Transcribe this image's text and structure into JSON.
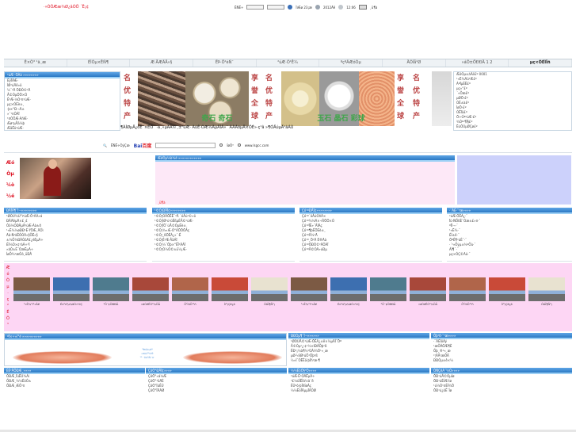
{
  "header": {
    "site_title": "·»ÒÔÆæ¾Ø¿âÓÖ ´Ë¡¢",
    "search_label": "ËÑË÷",
    "weather_label": "ÌìÆø 23¡æ",
    "date_label": "2012Äê",
    "time_label": "12:06",
    "go_button": "¸ü¶à"
  },
  "nav": {
    "items": [
      "Ê×Ò³ ¹ã¸æ",
      "ÉÌÒµ×ÊÑ¶",
      "Æ·ÅÆÃÅ»§",
      "ËÞ·Ö²éÑ¯",
      "²úÆ·Õ¹Ê¾",
      "ºçºÃÆóÒµ",
      "ÄÕÌå²Ø",
      "»áÔ±ÖÐÐÄ 1 2",
      "µç×ÓÉÌÎñ"
    ]
  },
  "left_categories": {
    "heading": "²úÆ··ÖÀà »»»»»»»»",
    "items": [
      "ÈýÏÂÆ·",
      "ÌØ²úÄê»õ",
      "½¨²Ä ÖÐÒ©²Ä",
      "Å©ÒµÖÖ×Ó",
      "Ê³Æ·¼Ó¹¤²úÆ·",
      "µç×ÓÉè±¸",
      "·þ×°Ð¬Ã±",
      "»¯¹¤Ô­ÁÏ",
      "¹¤ÒÕÆ·ÀñÆ·",
      "Æø³µÅä¼þ",
      "ÆäËû²úÆ·"
    ]
  },
  "banner": {
    "left_slogan": [
      "名",
      "优",
      "特",
      "产"
    ],
    "mid_slogan_a": [
      "享",
      "誉",
      "全",
      "球"
    ],
    "mid_slogan_b": [
      "名",
      "优",
      "特",
      "产"
    ],
    "right_slogan_a": [
      "享",
      "誉",
      "全",
      "球"
    ],
    "right_slogan_b": [
      "名",
      "优",
      "特",
      "产"
    ],
    "photo_caption_1": "奇石 奇石",
    "photo_caption_2": "玉石 晶石 彩球",
    "marquee": "¶ÀÌØµÄ¿óÊ¯×ÊÔ´ ·á¸»µÄÅ©¸±²úÆ· ÀúÊ·ÓÆ¾ÃµÄÎÄ»¯ ÃÀÀöµÄ×ÔÈ»·ç¹â »¶Ó­ÄúµÄ¹âÁÙ"
  },
  "right_list": {
    "items": [
      "ÆóÒµ±àÂë£º 0001",
      "¹«Ë¾Ãû³Æ£º",
      "ÁªÏµÈË£º",
      "µç»°£º",
      "´«Õæ£º",
      "µØÖ·£º",
      "ÓÊ±à£º",
      "ÍøÖ·£º",
      "ÓÊÏä£º",
      "Ö÷Óª²úÆ·£º",
      "¾­Óª·¶Î§£º",
      "ËùÔÚµØÇø£º",
      "×¢²á×Ê±¾£º",
      "ÆóÒµÀàÐÍ£º",
      "³ÉÁ¢Ê±¼ä£º"
    ]
  },
  "search_bar": {
    "logo_main": "Bai",
    "logo_accent": "百度",
    "label": "ËÑË÷ÒýÇæ",
    "placeholder": "",
    "option_web": "ÍøÒ³",
    "option_site": "www.lsgcc.com"
  },
  "profile": {
    "side_title": [
      "Æó",
      "Òµ",
      "¼ò",
      "½é"
    ],
    "heading": "ÆóÒµ¼ò½é »»»»»»»»»»»»",
    "red_note": "¸ü¶à"
  },
  "columns": [
    {
      "heading": "ÐÂÎÅ¶¯Ì¬»»»»»»»»",
      "items": [
        "¹ØÓÚ¾Ù°ì²úÆ·Õ¹ÀÀ»á",
        "ÐÂÄêµÄ×£¸£",
        "Ôö¼ÓÐÂµÄ²úÆ·Àà±ð",
        "¹«Ë¾½øÐÐ¹É·ÝÖÆ¸ÄÔì",
        "Ãâ·Ñ²âÊÔÓÃ»§ÕË»§",
        "±¾Õ¾ÐÂÔöÄ£¿éËµÃ÷",
        "ÉÌ¼Ò×¢²áÁ÷³Ì",
        "»áÔ±È¨ÒæËµÃ÷",
        "ÍøÕ¾¹æÔò¸üÐÂ"
      ]
    },
    {
      "heading": "¹©Ó¦ÐÅÏ¢»»»»»»»»",
      "items": [
        "¹©Ó¦ÓÅÖÊÊ¯²Ä ´óÅú¹©»õ",
        "¹©Ó¦ÌØ²ú¹ûÊßµÈÅ©²úÆ·",
        "¹©Ó¦ÏÖ´úÅ©ÒµÉè±¸",
        "¹©Ó¦¾«Æ·Ô°ÁÖÖÖÃç",
        "¹©Ó¦¸ßÖÊÁ¿»¯·Ê",
        "¹©Ó¦Ê³Æ·ÅäÁÏ",
        "¹©Ó¦½¨Öþ×°ÊÎ²ÄÁÏ",
        "¹©Ó¦Ò½Ò©±£½¡Æ·"
      ]
    },
    {
      "heading": "Çó¹ºÐÅÏ¢»»»»»»»»",
      "items": [
        "Çó¹º´óÅúÓñÃ×",
        "Çó¹º¾­¼Ã×÷ÎïÖÖ×Ó",
        "Çó¹ºÏÊ»¨ÂÌÃç",
        "Çó¹º¶þÊÖÉè±¸",
        "Çó¹ºÄ¾²Ä",
        "Çó¹º¸Ö²Ä Ë®Äà",
        "Çó¹ºÖÐÒ©²ÄÔ­ÁÏ",
        "Çó¹ºÅ©ÓÃ»úÐµ"
      ]
    },
    {
      "heading": "·¨ÂÉ·¨¹æ»»»»",
      "items": [
        "²úÆ·ÖÊÁ¿·¨",
        "Ïû·ÑÕßÈ¨Òæ±£»¤·¨",
        "ºÏÍ¬·¨",
        "¹«Ë¾·¨",
        "ÉÌ±ê·¨",
        "ÖªÊ¶²úÈ¨·¨",
        "·´²»Õýµ±¾ºÕù·¨",
        "ÀÍ¶¯·¨",
        "µç×ÓÇ©Ãû·¨"
      ]
    }
  ],
  "gallery": {
    "side_title": [
      "Æ",
      "ó",
      "Ò",
      "µ",
      "·",
      "ç",
      "²",
      "É",
      "Õ",
      "¹",
      "Ê",
      "¾"
    ],
    "items": [
      {
        "caption": "¹«Ë¾°ì¹«Â¥",
        "color": "#7c5a44"
      },
      {
        "caption": "Éú²ú³µ¼äÒ»½Ç",
        "color": "#3d6fb0"
      },
      {
        "caption": "²Ö´¢ÖÐÐÄ",
        "color": "#4f7b8e"
      },
      {
        "caption": "»áÒéÊÒ²¼ÖÃ",
        "color": "#a8483a"
      },
      {
        "caption": "Õ¹ÌüÕ¹¹ñ",
        "color": "#b0654a"
      },
      {
        "caption": "Ìï³¡Çé¿ö",
        "color": "#c94a38"
      },
      {
        "caption": "Ô­ÁÏ¶Ñ³¡",
        "color": "#e8e2d0"
      },
      {
        "caption": "¹«Ë¾°ì¹«Â¥",
        "color": "#7c5a44"
      },
      {
        "caption": "Éú²ú³µ¼äÒ»½Ç",
        "color": "#3d6fb0"
      },
      {
        "caption": "²Ö´¢ÖÐÐÄ",
        "color": "#4f7b8e"
      },
      {
        "caption": "»áÒéÊÒ²¼ÖÃ",
        "color": "#a8483a"
      },
      {
        "caption": "Õ¹ÌüÕ¹¹ñ",
        "color": "#b0654a"
      },
      {
        "caption": "Ìï³¡Çé¿ö",
        "color": "#c94a38"
      },
      {
        "caption": "Ô­ÁÏ¶Ñ³¡",
        "color": "#e8e2d0"
      }
    ]
  },
  "hands_section": {
    "heading": "ºÏ×÷»ï°é »»»»»»»»»»",
    "slogan_1": "³ÏÐÅ¾­Óª",
    "slogan_2": "»¥Àû¹²Ó®",
    "slogan_3": "¹²´´ÃÀºÃÎ´À´"
  },
  "news_mid": {
    "heading": "ÐÐÒµ¶¯Ì¬»»»»»»",
    "items": [
      "¹ØÓÚÅ©²úÆ·ÖÊÁ¿±ê×¼µÄÍ¨Öª",
      "Å©Òµ²¿·¢²¼×îÐÂÕþ²ß",
      "ÊÐ³¡¼à¶½¹ÜÀí¾Ö¹«¸æ",
      "µØ·½ÌØ²úÕ¹Õþ²ß",
      "½»Í¨ÔËÊä·þÎñ¹æ·¶",
      "ÖÐÐ¡ÆóÒµ·¢Õ¹Ö¸Òý",
      "»·±£²úÒµÕþ²ß½â¶Á"
    ]
  },
  "news_right": {
    "heading": "Õþ²ß·¨¹æ»»»»",
    "items": [
      "·¨ÂÉÌõÀý",
      "¹æÕÂÖÆ¶È",
      "Õþ¸®¹«¸æ",
      "²¦ÃÅ¹æÕÂ",
      "ÐÐÒµ±ê×¼",
      "¼¼Êõ¹æ·¶",
      "°²È«¹ÜÀí"
    ]
  },
  "bottom_cols": [
    {
      "heading": "ÈË²ÅÕÐÆ¸»»»»",
      "items": [
        "ÕÐÆ¸ÏúÊÛ¾­Àí",
        "ÕÐÆ¸¼¼ÊõÔ±",
        "ÕÐÆ¸ÆÕ¹¤"
      ]
    },
    {
      "heading": "ÇóÖ°ÐÅÏ¢»»»»",
      "items": [
        "ÇóÖ°»á¼Æ",
        "ÇóÖ°³öÄÉ",
        "ÇóÖ°ÏúÊÛ",
        "ÇóÖ°ÎÄÃØ"
      ]
    },
    {
      "heading": "¼¼ÊõÖ§³Ö»»»»",
      "items": [
        "²úÆ·Ê¹ÓÃËµÃ÷",
        "³£¼ûÎÊÌâ½â´ð",
        "ÊÛºó·þÎñÍøÂç",
        "¼¼ÊõÎÄµµÏÂÔØ"
      ]
    },
    {
      "heading": "ÓÑÇéÁ´½Ó»»»»",
      "items": [
        "ÖÐ¹úÅ©ÒµÍø",
        "ÖÐ¹úÉÌÆ·Íø",
        "¹ú¼Ò¹¤ÉÌ¾Ö",
        "ÖÐ¹ú¿óÊ¯Íø"
      ]
    }
  ]
}
